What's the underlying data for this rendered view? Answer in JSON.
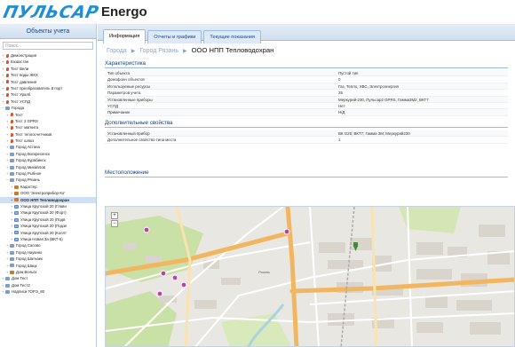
{
  "header": {
    "logo_text": "ПУЛЬСАР",
    "app_name": "Energo"
  },
  "left_panel": {
    "title": "Объекты учета",
    "search_placeholder": "Поиск...",
    "tree": [
      {
        "label": "Демонстрация",
        "icon": "pin-icon",
        "level": 0,
        "expander": "+"
      },
      {
        "label": "Казахстан",
        "icon": "pin-icon",
        "level": 0,
        "expander": "+"
      },
      {
        "label": "Тест Вели",
        "icon": "pin-icon",
        "level": 0,
        "expander": "+"
      },
      {
        "label": "Тест воды ЖКХ",
        "icon": "pin-icon",
        "level": 0,
        "expander": "+"
      },
      {
        "label": "Тест давления",
        "icon": "pin-icon",
        "level": 0,
        "expander": "+"
      },
      {
        "label": "Тест преобразователь 8 порт",
        "icon": "pin-icon",
        "level": 0,
        "expander": "+"
      },
      {
        "label": "Тест Уралб",
        "icon": "pin-icon",
        "level": 0,
        "expander": "+"
      },
      {
        "label": "Тест УСПД",
        "icon": "pin-icon",
        "level": 0,
        "expander": "+"
      },
      {
        "label": "Города",
        "icon": "city-icon",
        "level": 0,
        "expander": "−"
      },
      {
        "label": "Тест",
        "icon": "pin-icon",
        "level": 1,
        "expander": "+"
      },
      {
        "label": "Тест 2 GPRS",
        "icon": "pin-icon",
        "level": 1,
        "expander": "+"
      },
      {
        "label": "Тест магнита",
        "icon": "pin-icon",
        "level": 1,
        "expander": "+"
      },
      {
        "label": "Тест теплосчетчиков",
        "icon": "pin-icon",
        "level": 1,
        "expander": "+"
      },
      {
        "label": "Тест шлюз",
        "icon": "pin-icon",
        "level": 1,
        "expander": "+"
      },
      {
        "label": "Город Астана",
        "icon": "city-icon",
        "level": 1,
        "expander": "+"
      },
      {
        "label": "Город Воскресенск",
        "icon": "city-icon",
        "level": 1,
        "expander": "+"
      },
      {
        "label": "Город Курабинск",
        "icon": "city-icon",
        "level": 1,
        "expander": "+"
      },
      {
        "label": "Город Михайлов",
        "icon": "city-icon",
        "level": 1,
        "expander": "+"
      },
      {
        "label": "Город Рыбное",
        "icon": "city-icon",
        "level": 1,
        "expander": "+"
      },
      {
        "label": "Город Рязань",
        "icon": "city-icon",
        "level": 1,
        "expander": "−"
      },
      {
        "label": "Кадастер",
        "icon": "obj-icon",
        "level": 2,
        "expander": "+"
      },
      {
        "label": "ООО 'Электроприбор-Ко'",
        "icon": "obj-icon",
        "level": 2,
        "expander": "+"
      },
      {
        "label": "ООО НПП Тепловодохран",
        "icon": "obj-icon",
        "level": 2,
        "expander": "+",
        "selected": true
      },
      {
        "label": "Улица Крупской 20 (Главн",
        "icon": "addr-icon",
        "level": 2,
        "expander": "+"
      },
      {
        "label": "Улица Крупской 20 (Форт)",
        "icon": "addr-icon",
        "level": 2,
        "expander": "+"
      },
      {
        "label": "Улица Крупской 20 (Подв",
        "icon": "addr-icon",
        "level": 2,
        "expander": "+"
      },
      {
        "label": "Улица Крупской 20 (Подзе",
        "icon": "addr-icon",
        "level": 2,
        "expander": "+"
      },
      {
        "label": "Улица Крупской 20 (Коллт",
        "icon": "addr-icon",
        "level": 2,
        "expander": "+"
      },
      {
        "label": "Улица Новая 3а (ВКТ-5)",
        "icon": "addr-icon",
        "level": 2,
        "expander": "+"
      },
      {
        "label": "Город Сасово",
        "icon": "city-icon",
        "level": 1,
        "expander": "+"
      },
      {
        "label": "Город Наукино",
        "icon": "city-icon",
        "level": 1,
        "expander": "+"
      },
      {
        "label": "Город Шатнаек",
        "icon": "city-icon",
        "level": 1,
        "expander": "+"
      },
      {
        "label": "Город Шацк",
        "icon": "city-icon",
        "level": 1,
        "expander": "+"
      },
      {
        "label": "Дом Вельск",
        "icon": "obj-icon",
        "level": 1,
        "expander": "+"
      },
      {
        "label": "Дом Тест",
        "icon": "city-icon",
        "level": 0,
        "expander": "+"
      },
      {
        "label": "Дом Тест2",
        "icon": "city-icon",
        "level": 0,
        "expander": "+"
      },
      {
        "label": "Надписи ГОРЭ_80",
        "icon": "city-icon",
        "level": 0,
        "expander": "+"
      }
    ]
  },
  "tabs": [
    {
      "label": "Информация",
      "active": true
    },
    {
      "label": "Отчеты и графики",
      "active": false
    },
    {
      "label": "Текущие показания",
      "active": false
    }
  ],
  "breadcrumb": {
    "items": [
      "Города",
      "Город Рязань"
    ],
    "current": "ООО НПП Тепловодохран"
  },
  "characteristics": {
    "title": "Характеристика",
    "rows": [
      {
        "key": "Тип объекта",
        "value": "Пустой тип"
      },
      {
        "key": "Домофонн объектов",
        "value": "0"
      },
      {
        "key": "Используемые ресурсы",
        "value": "Газ, Тепло, ХВС, Электроэнергия"
      },
      {
        "key": "Параметров учета",
        "value": "35"
      },
      {
        "key": "Установленные приборы",
        "value": "Меркурий-230, Пульсар2 GPRS, Гамма3М2, ВКТ7"
      },
      {
        "key": "УСПД",
        "value": "Нет"
      },
      {
        "key": "Примечание",
        "value": "Н/Д"
      }
    ]
  },
  "extra_props": {
    "title": "Дополнительные свойства",
    "rows": [
      {
        "key": "Установленный прибор",
        "value": "ВК G25; ВКТ7; Гамма 3М; Меркурий230"
      },
      {
        "key": "Дополнительное свойство типа места",
        "value": "1"
      }
    ]
  },
  "location": {
    "title": "Местоположение",
    "zoom_in": "+",
    "zoom_out": "−",
    "map_labels": [
      "Рязань"
    ]
  },
  "colors": {
    "accent": "#15428b",
    "logo": "#1d8fd2",
    "marker": "#c03fb0",
    "road": "#f0b35c",
    "park": "#c5dfa0"
  }
}
